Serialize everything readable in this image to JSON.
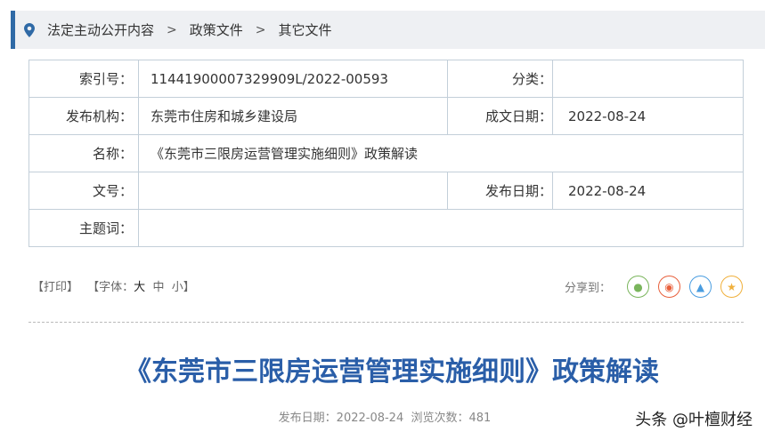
{
  "breadcrumb": [
    "法定主动公开内容",
    "政策文件",
    "其它文件"
  ],
  "info": {
    "index_label": "索引号：",
    "index_value": "11441900007329909L/2022-00593",
    "category_label": "分类：",
    "category_value": "",
    "publisher_label": "发布机构：",
    "publisher_value": "东莞市住房和城乡建设局",
    "written_date_label": "成文日期：",
    "written_date_value": "2022-08-24",
    "name_label": "名称：",
    "name_value": "《东莞市三限房运营管理实施细则》政策解读",
    "doc_no_label": "文号：",
    "doc_no_value": "",
    "publish_date_label": "发布日期：",
    "publish_date_value": "2022-08-24",
    "keywords_label": "主题词：",
    "keywords_value": ""
  },
  "tools": {
    "print": "【打印】",
    "font_prefix": "【字体：",
    "large": "大",
    "medium": "中",
    "small": "小",
    "font_suffix": "】"
  },
  "share": {
    "label": "分享到：",
    "colors": {
      "wechat": "#7ab55c",
      "weibo": "#e8603c",
      "qq": "#4a9de0",
      "favorite": "#f0b03c"
    }
  },
  "article": {
    "title": "《东莞市三限房运营管理实施细则》政策解读",
    "meta": "发布日期：2022-08-24  浏览次数：481"
  },
  "watermark": "头条 @叶檀财经"
}
